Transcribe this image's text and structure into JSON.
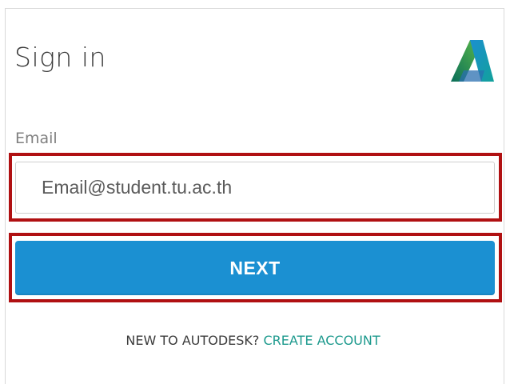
{
  "header": {
    "title": "Sign in",
    "logo_icon": "autodesk-logo-icon"
  },
  "form": {
    "email_label": "Email",
    "email_value": "Email@student.tu.ac.th",
    "next_label": "NEXT"
  },
  "footer": {
    "prompt": "NEW TO AUTODESK?",
    "create_account_label": "CREATE ACCOUNT"
  },
  "colors": {
    "primary_button": "#1b90d2",
    "link": "#1e9a8e",
    "highlight_border": "#b01012"
  }
}
